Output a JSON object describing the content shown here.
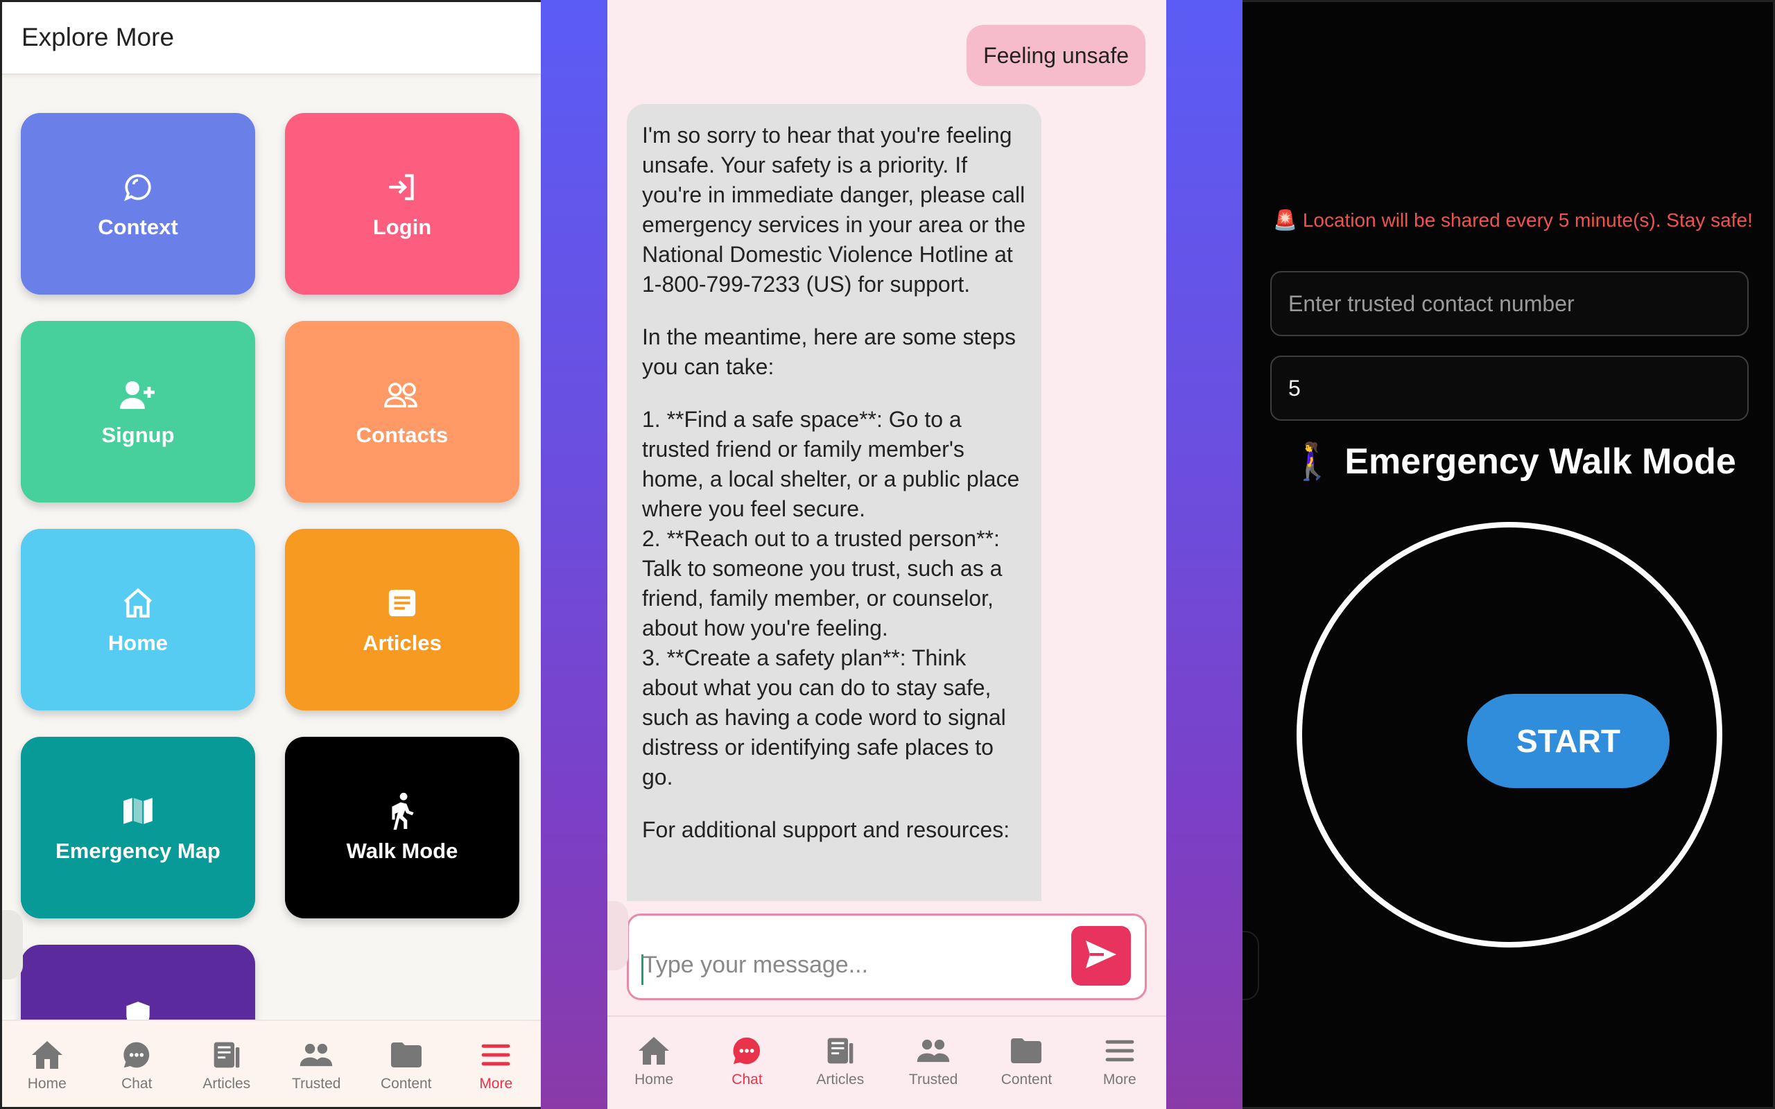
{
  "explore": {
    "title": "Explore More",
    "tiles": [
      {
        "label": "Context",
        "icon": "chat-bubble-icon",
        "color": "#6b7fe8"
      },
      {
        "label": "Login",
        "icon": "login-icon",
        "color": "#fd5d7f"
      },
      {
        "label": "Signup",
        "icon": "add-user-icon",
        "color": "#48d09c"
      },
      {
        "label": "Contacts",
        "icon": "contacts-icon",
        "color": "#ff9a67"
      },
      {
        "label": "Home",
        "icon": "home-icon",
        "color": "#56ccf2"
      },
      {
        "label": "Articles",
        "icon": "article-icon",
        "color": "#f79a22"
      },
      {
        "label": "Emergency Map",
        "icon": "map-icon",
        "color": "#079a96"
      },
      {
        "label": "Walk Mode",
        "icon": "walking-icon",
        "color": "#000000"
      },
      {
        "label": "",
        "icon": "shield-icon",
        "color": "#5b2a9c"
      }
    ]
  },
  "nav_left": {
    "items": [
      {
        "label": "Home",
        "icon": "home-icon"
      },
      {
        "label": "Chat",
        "icon": "chat-icon"
      },
      {
        "label": "Articles",
        "icon": "articles-icon"
      },
      {
        "label": "Trusted",
        "icon": "people-icon"
      },
      {
        "label": "Content",
        "icon": "folder-icon"
      },
      {
        "label": "More",
        "icon": "menu-icon"
      }
    ],
    "active": "More"
  },
  "chat": {
    "user_message": "Feeling unsafe",
    "bot_paragraphs": [
      "I'm so sorry to hear that you're feeling unsafe. Your safety is a priority. If you're in immediate danger, please call emergency services in your area or the National Domestic Violence Hotline at 1-800-799-7233 (US) for support.",
      "In the meantime, here are some steps you can take:",
      "1. **Find a safe space**: Go to a trusted friend or family member's home, a local shelter, or a public place where you feel secure.\n2. **Reach out to a trusted person**: Talk to someone you trust, such as a friend, family member, or counselor, about how you're feeling.\n3. **Create a safety plan**: Think about what you can do to stay safe, such as having a code word to signal distress or identifying safe places to go.",
      "For additional support and resources:"
    ],
    "input_placeholder": "Type your message...",
    "send_icon": "send-icon"
  },
  "nav_mid": {
    "items": [
      {
        "label": "Home"
      },
      {
        "label": "Chat"
      },
      {
        "label": "Articles"
      },
      {
        "label": "Trusted"
      },
      {
        "label": "Content"
      },
      {
        "label": "More"
      }
    ],
    "active": "Chat"
  },
  "walk": {
    "notice": "🚨 Location will be shared every 5 minute(s). Stay safe!",
    "contact_placeholder": "Enter trusted contact number",
    "interval_value": "5",
    "title": "🚶‍♀️ Emergency Walk Mode",
    "start_label": "START"
  }
}
